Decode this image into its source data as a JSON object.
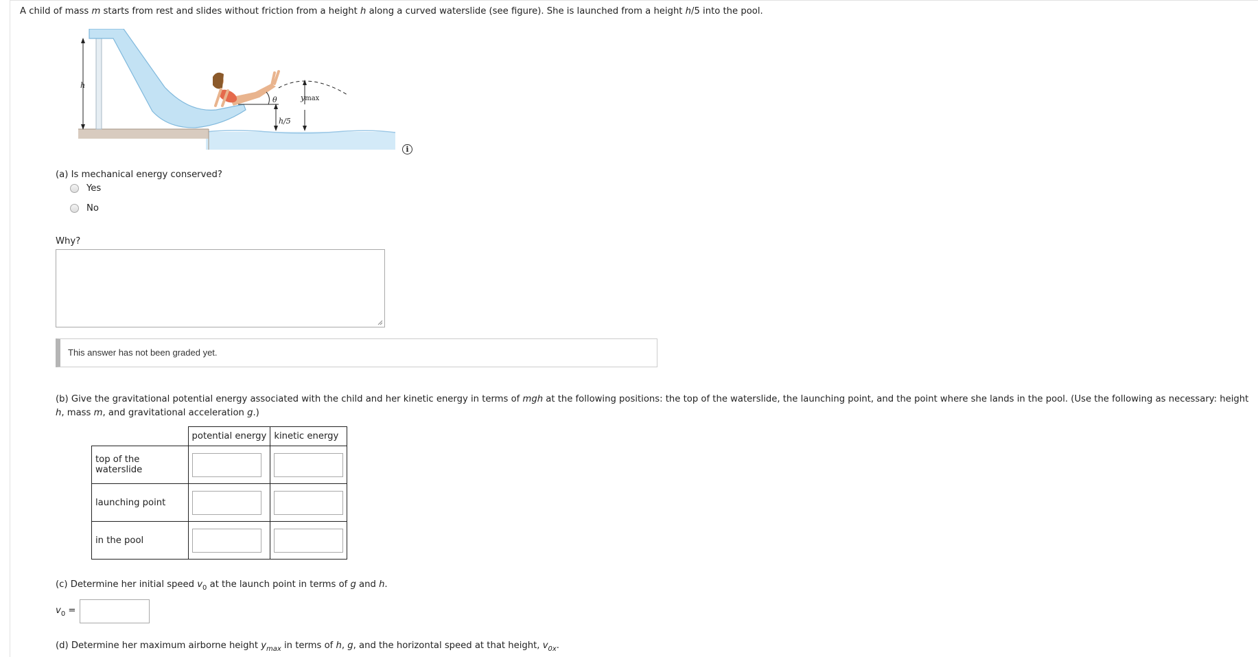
{
  "intro": {
    "t1": "A child of mass ",
    "m": "m",
    "t2": " starts from rest and slides without friction from a height ",
    "h": "h",
    "t3": " along a curved waterslide (see figure). She is launched from a height ",
    "h5": "h",
    "t4": "/5 into the pool."
  },
  "figure": {
    "label_h": "h",
    "label_theta": "θ",
    "label_ymax_y": "y",
    "label_ymax_sub": "max",
    "label_h5": "h/5",
    "icon": "person-on-slide-illustration"
  },
  "info_icon": "i",
  "part_a": {
    "question": "(a) Is mechanical energy conserved?",
    "options": [
      "Yes",
      "No"
    ]
  },
  "why": {
    "label": "Why?",
    "value": ""
  },
  "graded_notice": "This answer has not been graded yet.",
  "part_b": {
    "p1": "(b) Give the gravitational potential energy associated with the child and her kinetic energy in terms of ",
    "mgh": "mgh",
    "p2": " at the following positions: the top of the waterslide, the launching point, and the point where she lands in the pool. (Use the following as necessary: height",
    "h": "h",
    "p3": ", mass ",
    "m": "m",
    "p4": ", and gravitational acceleration ",
    "g": "g",
    "p5": ".)",
    "col_headers": [
      "potential energy",
      "kinetic energy"
    ],
    "rows": [
      "top of the waterslide",
      "launching point",
      "in the pool"
    ]
  },
  "part_c": {
    "t1": "(c) Determine her initial speed ",
    "v": "v",
    "sub": "0",
    "t2": " at the launch point in terms of ",
    "g": "g",
    "t3": " and ",
    "h": "h",
    "t4": ".",
    "label_v": "v",
    "label_sub": "0",
    "label_eq": " =",
    "value": ""
  },
  "part_d": {
    "t1": "(d) Determine her maximum airborne height ",
    "y": "y",
    "ysub": "max",
    "t2": " in terms of ",
    "h": "h",
    "t3": ", ",
    "g": "g",
    "t4": ", and the horizontal speed at that height, ",
    "v": "v",
    "vsub": "0x",
    "t5": "."
  },
  "colors": {
    "slide": "#c3e2f4",
    "slide_stroke": "#7fb8dc",
    "ground": "#d8cbbf",
    "water": "#d3eaf8"
  }
}
